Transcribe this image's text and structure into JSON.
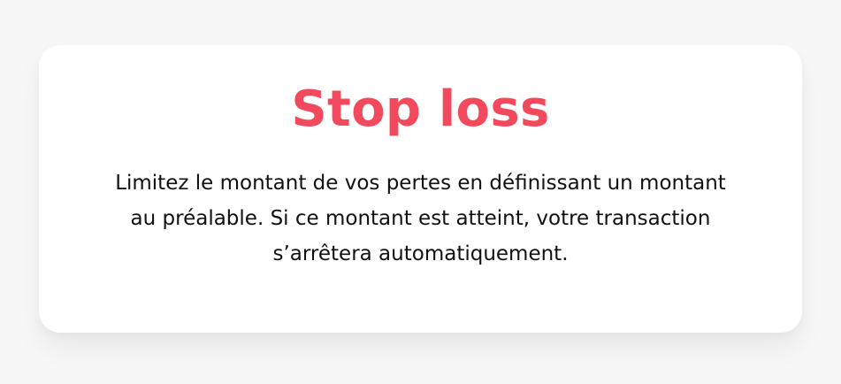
{
  "card": {
    "title": "Stop loss",
    "description": "Limitez le montant de vos pertes en définissant un montant au préalable. Si ce montant est atteint, votre transaction s’arrêtera automatiquement."
  },
  "colors": {
    "accent": "#f2495c",
    "page_background": "#f7f7f8",
    "card_background": "#ffffff",
    "text": "#111111"
  }
}
